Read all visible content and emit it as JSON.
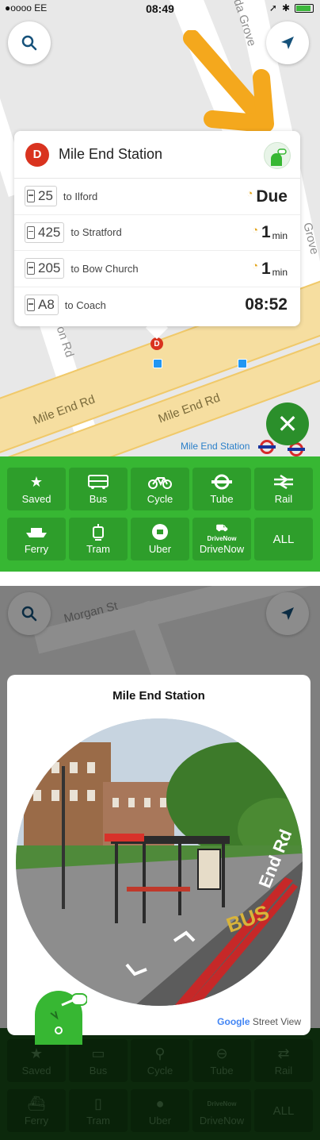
{
  "status_bar": {
    "carrier": "●oooo EE",
    "time": "08:49"
  },
  "map": {
    "street_labels": [
      "Mile End Rd",
      "Mile End Rd",
      "on Rd",
      "Mile End Station",
      "Morgan St",
      "da Grove",
      "Grove"
    ],
    "station_label": "Mile End Station"
  },
  "stop_card": {
    "badge": "D",
    "stop_name": "Mile End Station",
    "departures": [
      {
        "route": "25",
        "destination": "to Ilford",
        "eta": "Due",
        "unit": "",
        "live": true
      },
      {
        "route": "425",
        "destination": "to Stratford",
        "eta": "1",
        "unit": "min",
        "live": true
      },
      {
        "route": "205",
        "destination": "to Bow Church",
        "eta": "1",
        "unit": "min",
        "live": true
      },
      {
        "route": "A8",
        "destination": "to Coach",
        "eta": "08:52",
        "unit": "",
        "live": false
      }
    ]
  },
  "transport_modes": [
    {
      "label": "Saved",
      "icon": "star-icon"
    },
    {
      "label": "Bus",
      "icon": "bus-icon"
    },
    {
      "label": "Cycle",
      "icon": "bicycle-icon"
    },
    {
      "label": "Tube",
      "icon": "tube-roundel-icon"
    },
    {
      "label": "Rail",
      "icon": "rail-icon"
    },
    {
      "label": "Ferry",
      "icon": "ferry-icon"
    },
    {
      "label": "Tram",
      "icon": "tram-icon"
    },
    {
      "label": "Uber",
      "icon": "uber-icon"
    },
    {
      "label": "DriveNow",
      "icon": "drivenow-icon",
      "icon_text": "DriveNow"
    },
    {
      "label": "ALL",
      "icon": ""
    }
  ],
  "street_view": {
    "title": "Mile End Station",
    "brand_google": "Google",
    "brand_sv": "Street View",
    "road_text": [
      "BUS",
      "End Rd"
    ]
  },
  "colors": {
    "brand_green": "#37b733",
    "stop_red": "#d9331f",
    "live_orange": "#e3a51b"
  }
}
